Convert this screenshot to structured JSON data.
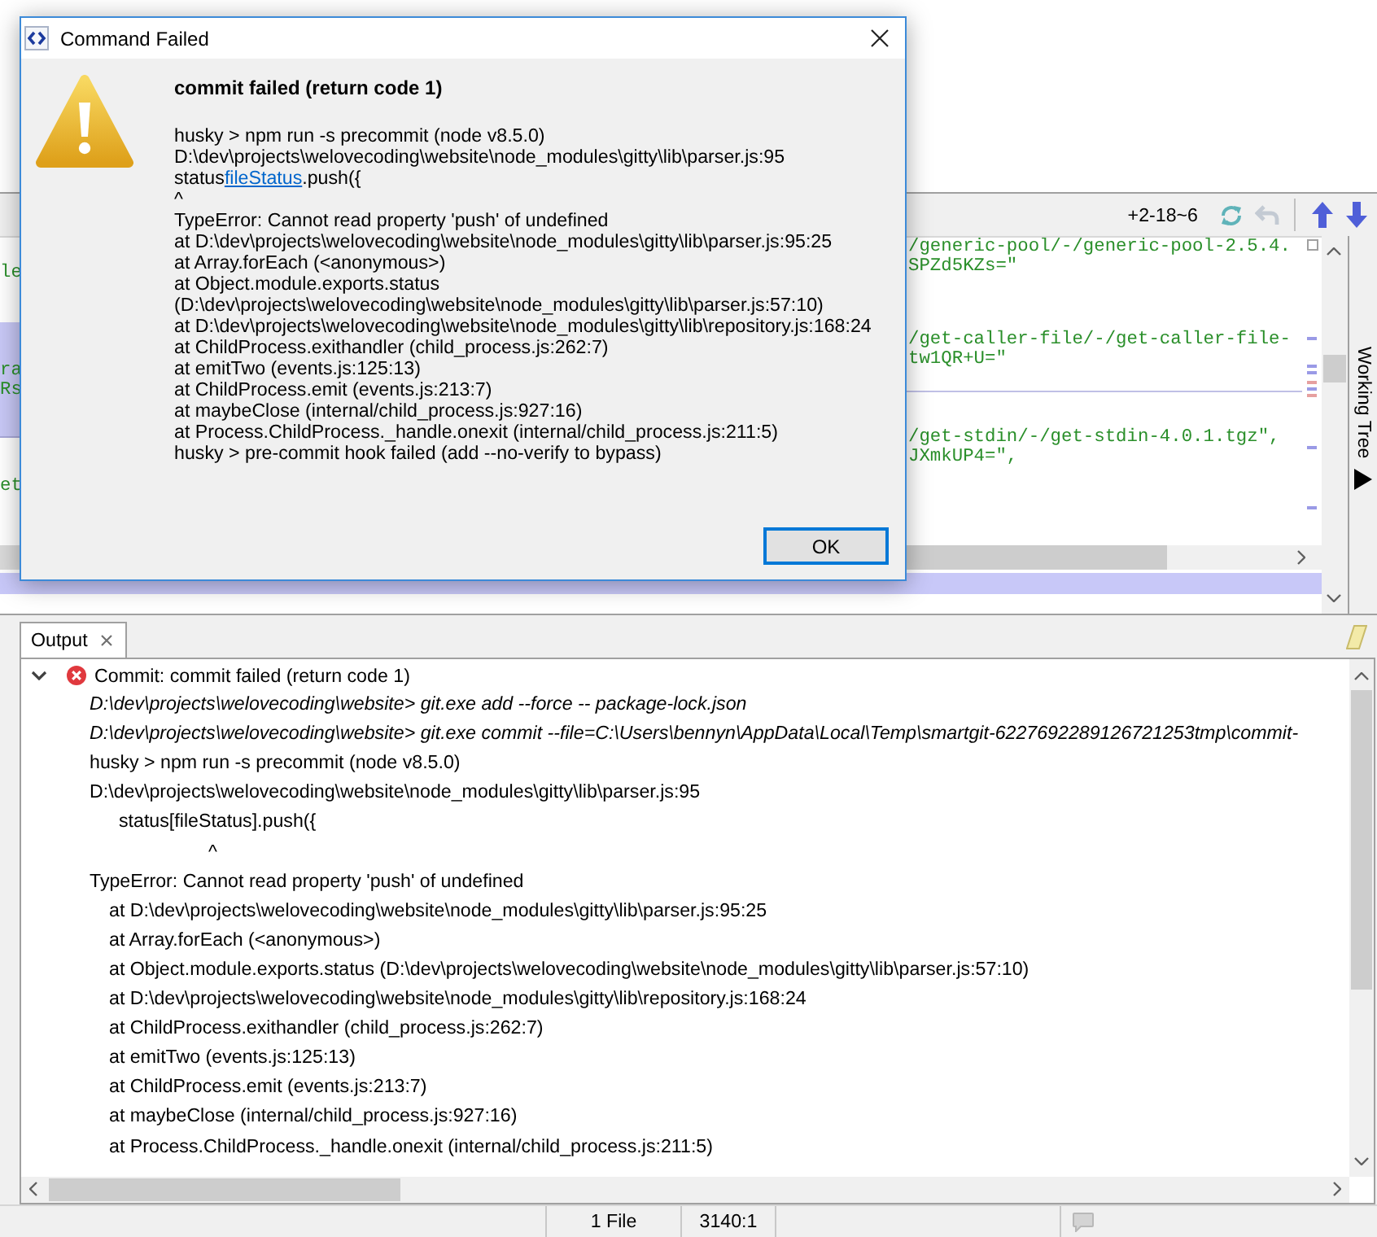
{
  "dialog": {
    "title": "Command Failed",
    "heading": "commit failed (return code 1)",
    "message": [
      {
        "kind": "text",
        "text": "husky > npm run -s precommit (node v8.5.0)"
      },
      {
        "kind": "text",
        "text": "D:\\dev\\projects\\welovecoding\\website\\node_modules\\gitty\\lib\\parser.js:95"
      },
      {
        "kind": "link",
        "before": "status",
        "link": "fileStatus",
        "after": ".push({"
      },
      {
        "kind": "text",
        "text": "^"
      },
      {
        "kind": "text",
        "text": "TypeError: Cannot read property 'push' of undefined"
      },
      {
        "kind": "text",
        "text": "at D:\\dev\\projects\\welovecoding\\website\\node_modules\\gitty\\lib\\parser.js:95:25"
      },
      {
        "kind": "text",
        "text": "at Array.forEach (<anonymous>)"
      },
      {
        "kind": "text",
        "text": "at Object.module.exports.status (D:\\dev\\projects\\welovecoding\\website\\node_modules\\gitty\\lib\\parser.js:57:10)"
      },
      {
        "kind": "text",
        "text": "at D:\\dev\\projects\\welovecoding\\website\\node_modules\\gitty\\lib\\repository.js:168:24"
      },
      {
        "kind": "text",
        "text": "at ChildProcess.exithandler (child_process.js:262:7)"
      },
      {
        "kind": "text",
        "text": "at emitTwo (events.js:125:13)"
      },
      {
        "kind": "text",
        "text": "at ChildProcess.emit (events.js:213:7)"
      },
      {
        "kind": "text",
        "text": "at maybeClose (internal/child_process.js:927:16)"
      },
      {
        "kind": "text",
        "text": "at Process.ChildProcess._handle.onexit (internal/child_process.js:211:5)"
      },
      {
        "kind": "text",
        "text": "husky > pre-commit hook failed (add --no-verify to bypass)"
      }
    ],
    "ok_button": "OK"
  },
  "toolbar": {
    "change_summary": "+2-18~6"
  },
  "left_pane": {
    "hunks": [
      {
        "highlighted": false,
        "lines": [
          "le"
        ]
      },
      {
        "highlighted": true,
        "lines": [
          "ra",
          "Rs"
        ]
      },
      {
        "highlighted": false,
        "lines": [
          "et"
        ]
      }
    ]
  },
  "editor": {
    "hunks": [
      {
        "lines": [
          "/generic-pool/-/generic-pool-2.5.4.",
          "SPZd5KZs=\""
        ]
      },
      {
        "lines": [
          "/get-caller-file/-/get-caller-file-",
          "tw1QR+U=\""
        ]
      },
      {
        "lines": [
          "/get-stdin/-/get-stdin-4.0.1.tgz\",",
          "JXmkUP4=\","
        ]
      }
    ]
  },
  "side_tab": {
    "label": "Working Tree"
  },
  "output": {
    "tabs": [
      {
        "label": "Output",
        "selected": true
      }
    ],
    "entries": [
      {
        "title": "Commit: commit failed (return code 1)",
        "failed": true,
        "expanded": true,
        "lines": [
          {
            "kind": "command",
            "text": "D:\\dev\\projects\\welovecoding\\website> git.exe add --force -- package-lock.json"
          },
          {
            "kind": "command",
            "text": "D:\\dev\\projects\\welovecoding\\website> git.exe commit --file=C:\\Users\\bennyn\\AppData\\Local\\Temp\\smartgit-6227692289126721253tmp\\commit-"
          },
          {
            "kind": "text",
            "text": "husky > npm run -s precommit (node v8.5.0)"
          },
          {
            "kind": "text",
            "text": "D:\\dev\\projects\\welovecoding\\website\\node_modules\\gitty\\lib\\parser.js:95"
          },
          {
            "kind": "code",
            "text": "status[fileStatus].push({"
          },
          {
            "kind": "pointer",
            "text": "^"
          },
          {
            "kind": "text",
            "text": "TypeError: Cannot read property 'push' of undefined"
          },
          {
            "kind": "trace",
            "text": "at D:\\dev\\projects\\welovecoding\\website\\node_modules\\gitty\\lib\\parser.js:95:25"
          },
          {
            "kind": "trace",
            "text": "at Array.forEach (<anonymous>)"
          },
          {
            "kind": "trace",
            "text": "at Object.module.exports.status (D:\\dev\\projects\\welovecoding\\website\\node_modules\\gitty\\lib\\parser.js:57:10)"
          },
          {
            "kind": "trace",
            "text": "at D:\\dev\\projects\\welovecoding\\website\\node_modules\\gitty\\lib\\repository.js:168:24"
          },
          {
            "kind": "trace",
            "text": "at ChildProcess.exithandler (child_process.js:262:7)"
          },
          {
            "kind": "trace",
            "text": "at emitTwo (events.js:125:13)"
          },
          {
            "kind": "trace",
            "text": "at ChildProcess.emit (events.js:213:7)"
          },
          {
            "kind": "trace",
            "text": "at maybeClose (internal/child_process.js:927:16)"
          },
          {
            "kind": "trace",
            "text": "at Process.ChildProcess._handle.onexit (internal/child_process.js:211:5)"
          }
        ]
      }
    ]
  },
  "status_bar": {
    "files": "1 File",
    "position": "3140:1"
  }
}
